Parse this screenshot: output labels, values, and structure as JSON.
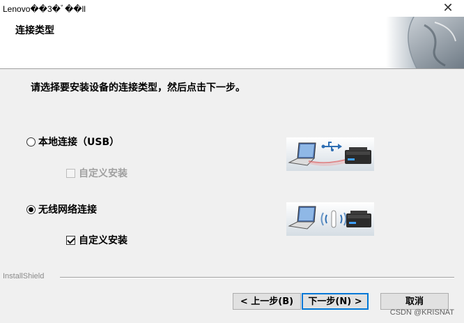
{
  "window": {
    "title": "Lenovo��3�ﾞ��ll",
    "close_glyph": "✕"
  },
  "header": {
    "title": "连接类型"
  },
  "instruction": "请选择要安装设备的连接类型，然后点击下一步。",
  "options": {
    "local": {
      "label": "本地连接（USB）",
      "selected": false
    },
    "local_custom": {
      "label": "自定义安装",
      "checked": false,
      "enabled": false
    },
    "wireless": {
      "label": "无线网络连接",
      "selected": true
    },
    "wireless_custom": {
      "label": "自定义安装",
      "checked": true,
      "enabled": true
    }
  },
  "footer": {
    "brand": "InstallShield"
  },
  "buttons": {
    "back": "< 上一步(B)",
    "next": "下一步(N) >",
    "cancel": "取消"
  },
  "watermark": "CSDN @KRISNAT",
  "colors": {
    "accent": "#0078d7",
    "usb_line": "#e05050"
  },
  "icons": [
    "laptop-icon",
    "usb-icon",
    "printer-icon",
    "wifi-antenna-icon"
  ]
}
